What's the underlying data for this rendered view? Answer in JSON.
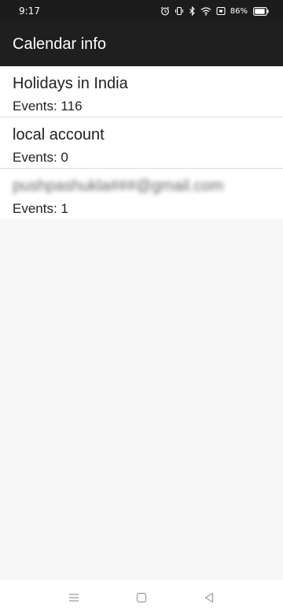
{
  "status_bar": {
    "time": "9:17",
    "battery_percent": "86%",
    "icons": [
      "alarm-icon",
      "vibrate-icon",
      "bluetooth-icon",
      "wifi-icon",
      "nfc-icon",
      "battery-icon"
    ]
  },
  "app_bar": {
    "title": "Calendar info"
  },
  "calendars": [
    {
      "title": "Holidays in India",
      "events": "Events: 116"
    },
    {
      "title": "local account",
      "events": "Events: 0"
    },
    {
      "title": "pushpashukla###@gmail.com",
      "events": "Events: 1"
    }
  ],
  "nav_bar": {
    "icons": [
      "menu-icon",
      "home-icon",
      "back-icon"
    ]
  },
  "colors": {
    "app_bar_bg": "#1f1f1f",
    "status_bar_bg": "#1c1c1c",
    "list_bg": "#ffffff",
    "page_bg": "#f7f7f7",
    "divider": "#dcdcdc"
  }
}
